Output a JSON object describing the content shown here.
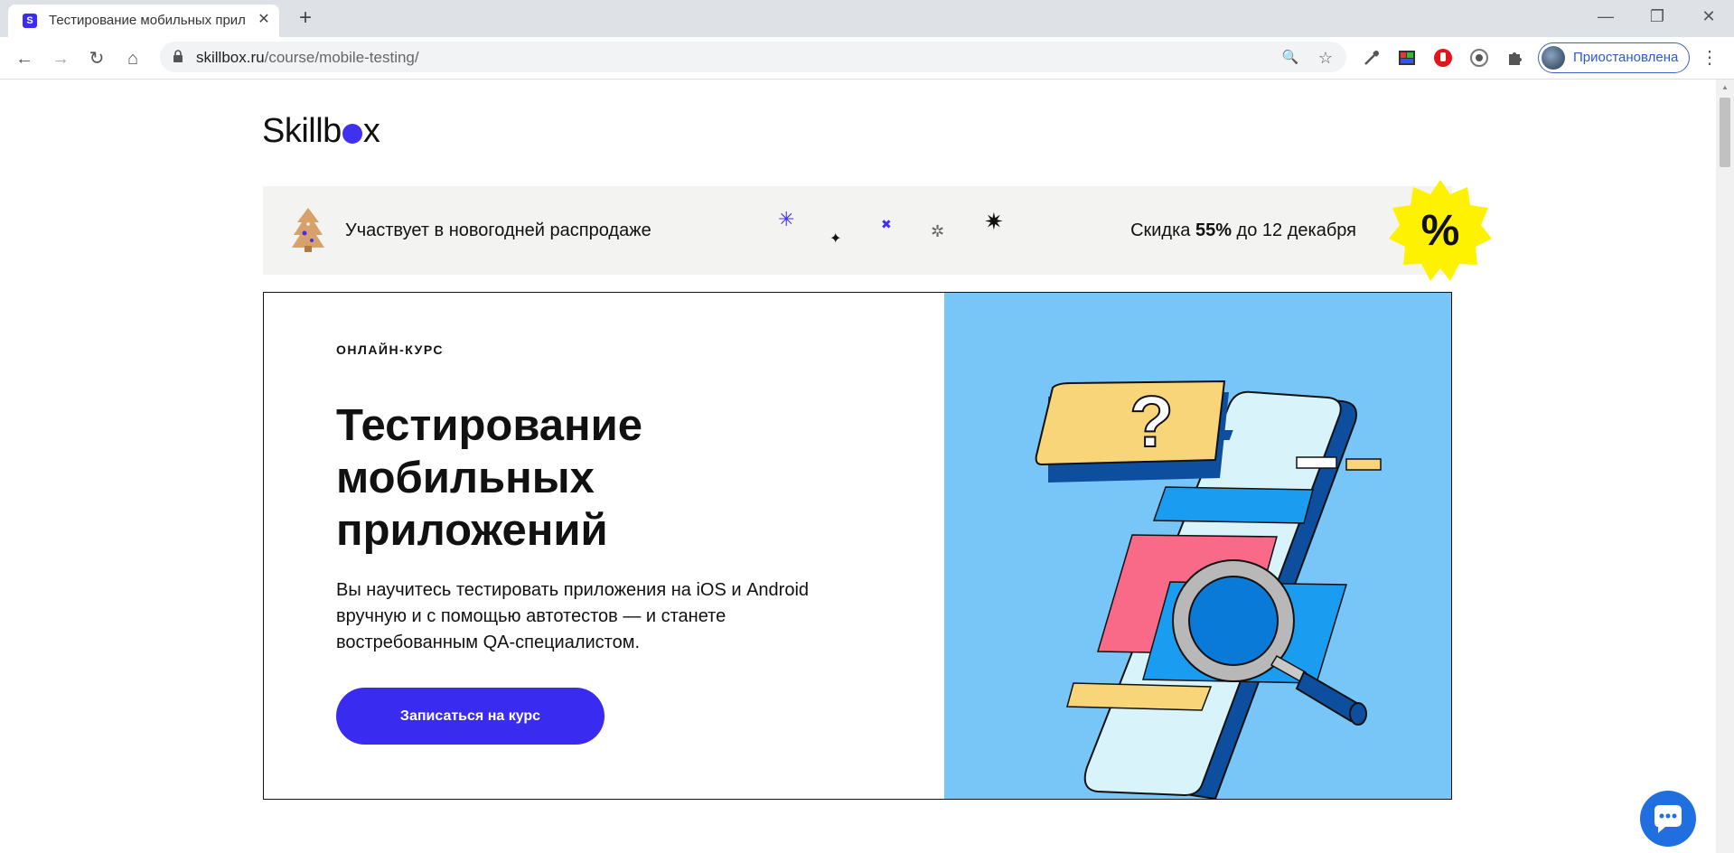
{
  "browser": {
    "tab": {
      "favicon_letter": "S",
      "title": "Тестирование мобильных прил",
      "close": "✕"
    },
    "new_tab": "+",
    "window_controls": {
      "minimize": "—",
      "restore": "❐",
      "close": "✕"
    },
    "nav": {
      "back": "←",
      "forward": "→",
      "reload": "↻",
      "home": "⌂"
    },
    "url": {
      "domain": "skillbox.ru",
      "path": "/course/mobile-testing/"
    },
    "omnibox_icons": {
      "zoom": "🔍",
      "bookmark": "☆"
    },
    "extensions": [
      "eyedropper-icon",
      "color-picker-icon",
      "adblock-icon",
      "speech-icon",
      "puzzle-icon"
    ],
    "profile": {
      "label": "Приостановлена"
    },
    "menu": "⋮"
  },
  "page": {
    "logo": {
      "prefix": "Skillb",
      "suffix": "x"
    },
    "promo": {
      "text": "Участвует в новогодней распродаже",
      "discount_prefix": "Скидка ",
      "discount_value": "55%",
      "discount_suffix": " до 12 декабря",
      "badge": "%",
      "sparkles": [
        "✳",
        "✦",
        "✖",
        "✲",
        "✷"
      ],
      "colors": {
        "purple": "#4030f0",
        "black": "#111111",
        "badge": "#fff200"
      }
    },
    "hero": {
      "kicker": "ОНЛАЙН-КУРС",
      "title": "Тестирование мобильных приложений",
      "description": "Вы научитесь тестировать приложения на iOS и Android вручную и с помощью автотестов — и станете востребованным QA-специалистом.",
      "cta": "Записаться на курс",
      "colors": {
        "accent": "#3a2bf0",
        "illustration_bg": "#78c6f7"
      }
    },
    "chat_button": "chat-icon"
  }
}
